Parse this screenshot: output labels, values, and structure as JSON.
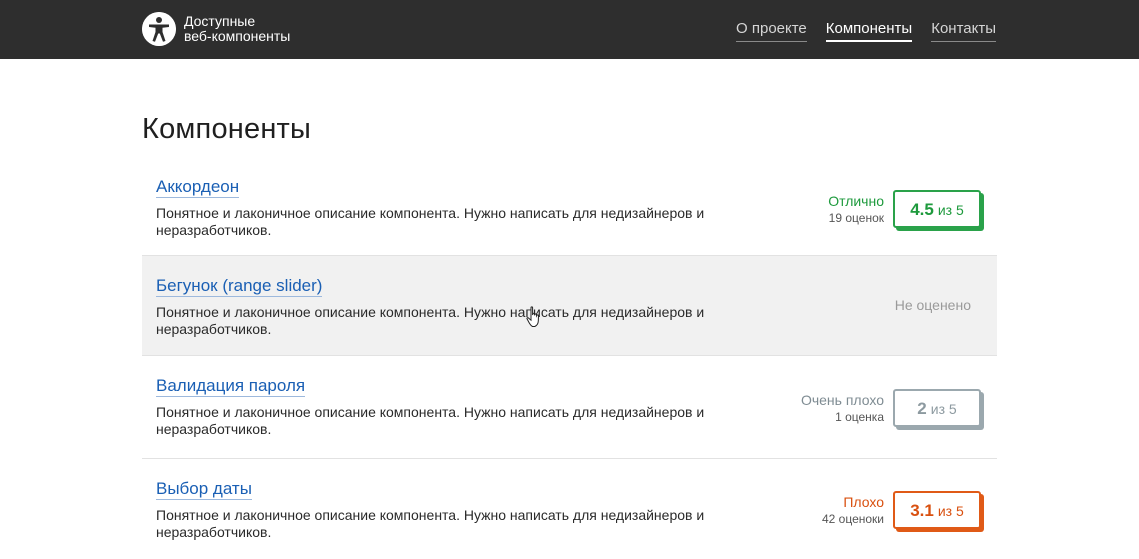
{
  "header": {
    "brand_line1": "Доступные",
    "brand_line2": "веб-компоненты",
    "nav": [
      {
        "label": "О проекте",
        "active": false
      },
      {
        "label": "Компоненты",
        "active": true
      },
      {
        "label": "Контакты",
        "active": false
      }
    ]
  },
  "main": {
    "title": "Компоненты",
    "items": [
      {
        "title": "Аккордеон",
        "description": "Понятное и лаконичное описание компонента. Нужно написать для недизайнеров и неразработчиков.",
        "rating_label": "Отлично",
        "rating_count": "19 оценок",
        "score": "4.5",
        "score_of": "из 5"
      },
      {
        "title": "Бегунок (range slider)",
        "description": "Понятное и лаконичное описание компонента. Нужно написать для недизайнеров и неразработчиков.",
        "unrated_label": "Не оценено"
      },
      {
        "title": "Валидация пароля",
        "description": "Понятное и лаконичное описание компонента. Нужно написать для недизайнеров и неразработчиков.",
        "rating_label": "Очень плохо",
        "rating_count": "1 оценка",
        "score": "2",
        "score_of": "из 5"
      },
      {
        "title": "Выбор даты",
        "description": "Понятное и лаконичное описание компонента. Нужно написать для недизайнеров и неразработчиков.",
        "rating_label": "Плохо",
        "rating_count": "42 оценоки",
        "score": "3.1",
        "score_of": "из 5"
      }
    ]
  },
  "colors": {
    "header_bg": "#2e2e2e",
    "link": "#1a5fb4",
    "excellent": "#1e9a3d",
    "very_bad": "#8d9aa0",
    "bad": "#d9500f",
    "hover_row": "#f1f1f1"
  },
  "icons": {
    "logo": "accessibility-icon",
    "cursor": "hand-pointer-icon"
  }
}
